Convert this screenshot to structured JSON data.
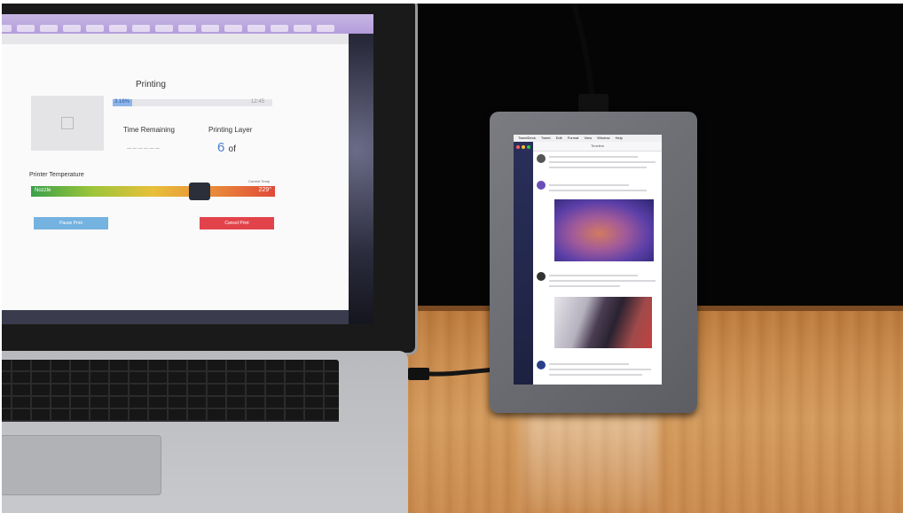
{
  "laptop": {
    "app_title": "Printing",
    "progress_label": "3.16%",
    "progress_fraction": 0.12,
    "progress_total": "12:45",
    "time_remaining_label": "Time Remaining",
    "printing_layer_label": "Printing Layer",
    "layer_value": "6",
    "layer_of": "of",
    "temp_title": "Printer Temperature",
    "temp_readout_label": "Current Temp",
    "nozzle_label": "Nozzle",
    "temp_value": "229°",
    "pause_button": "Pause Print",
    "cancel_button": "Cancel Print"
  },
  "tablet": {
    "menu": [
      "TweetDeck",
      "Tweet",
      "Edit",
      "Format",
      "View",
      "Window",
      "Help"
    ],
    "column_title": "Timeline"
  },
  "colors": {
    "progress": "#8fb5e8",
    "cancel": "#e2434b",
    "pause": "#74b2e0",
    "sidebar": "#2a2f5a"
  }
}
